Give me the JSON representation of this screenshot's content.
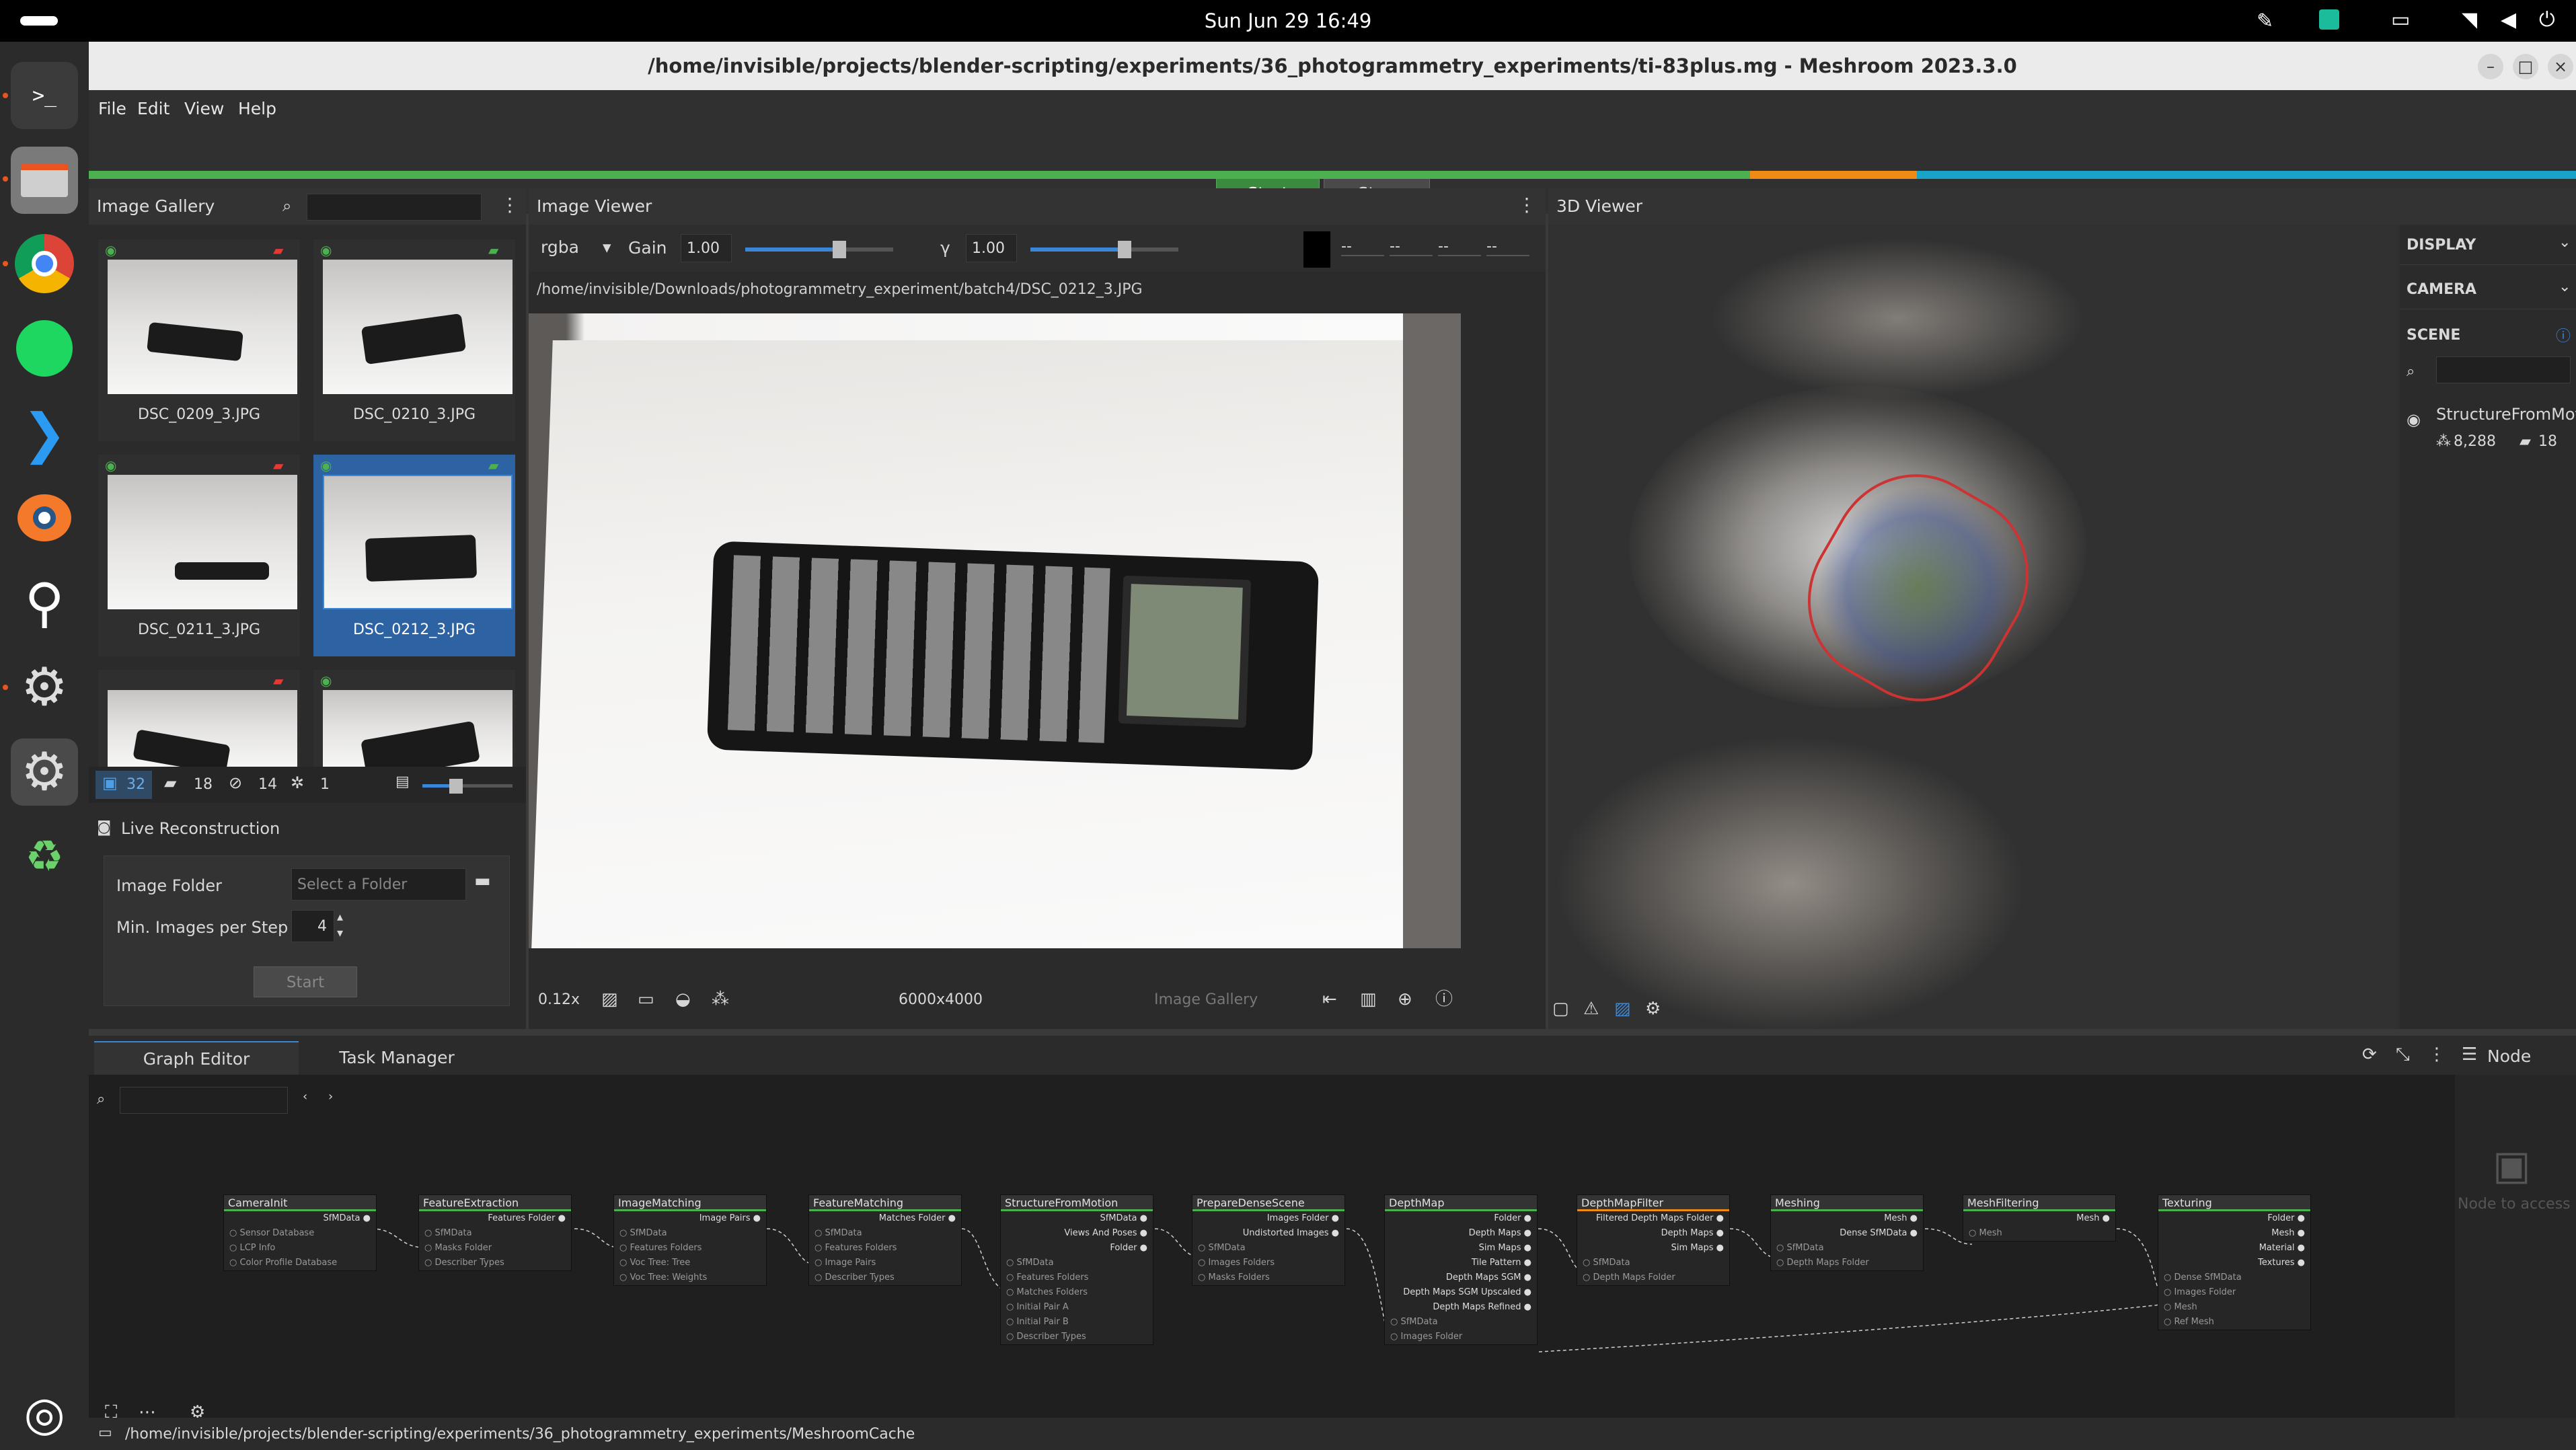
{
  "topbar": {
    "clock": "Sun Jun 29  16:49"
  },
  "window": {
    "title": "/home/invisible/projects/blender-scripting/experiments/36_photogrammetry_experiments/ti-83plus.mg - Meshroom 2023.3.0"
  },
  "menu": [
    "File",
    "Edit",
    "View",
    "Help"
  ],
  "actions": {
    "start": "Start",
    "stop": "Stop"
  },
  "gallery": {
    "title": "Image Gallery",
    "images": [
      {
        "name": "DSC_0209_3.JPG"
      },
      {
        "name": "DSC_0210_3.JPG"
      },
      {
        "name": "DSC_0211_3.JPG"
      },
      {
        "name": "DSC_0212_3.JPG"
      },
      {
        "name": "",
        "hidden": true
      },
      {
        "name": "",
        "hidden": true
      }
    ],
    "counts": {
      "images": "32",
      "cameras": "18",
      "no_cameras": "14",
      "intrinsics": "1"
    }
  },
  "live": {
    "title": "Live Reconstruction",
    "folder_label": "Image Folder",
    "folder_placeholder": "Select a Folder",
    "min_label": "Min. Images per Step",
    "min_value": "4",
    "start": "Start"
  },
  "viewer": {
    "title": "Image Viewer",
    "channel": "rgba",
    "gain_label": "Gain",
    "gain": "1.00",
    "gamma_label": "γ",
    "gamma": "1.00",
    "rgba_vals": [
      "--",
      "--",
      "--",
      "--"
    ],
    "path": "/home/invisible/Downloads/photogrammetry_experiment/batch4/DSC_0212_3.JPG",
    "zoom": "0.12x",
    "resolution": "6000x4000",
    "source": "Image Gallery"
  },
  "viewer3d": {
    "title": "3D Viewer",
    "sections": {
      "display": "DISPLAY",
      "camera": "CAMERA",
      "scene": "SCENE"
    },
    "scene_item": "StructureFromMotion",
    "points": "8,288",
    "cameras": "18"
  },
  "graph": {
    "tabs": [
      "Graph Editor",
      "Task Manager"
    ],
    "node_label": "Node",
    "node_placeholder": "Node to access i",
    "nodes": [
      {
        "name": "CameraInit",
        "outs": [
          "SfMData"
        ],
        "ins": [
          "Sensor Database",
          "LCP Info",
          "Color Profile Database"
        ]
      },
      {
        "name": "FeatureExtraction",
        "outs": [
          "Features Folder"
        ],
        "ins": [
          "SfMData",
          "Masks Folder",
          "Describer Types"
        ]
      },
      {
        "name": "ImageMatching",
        "outs": [
          "Image Pairs"
        ],
        "ins": [
          "SfMData",
          "Features Folders",
          "Voc Tree: Tree",
          "Voc Tree: Weights"
        ]
      },
      {
        "name": "FeatureMatching",
        "outs": [
          "Matches Folder"
        ],
        "ins": [
          "SfMData",
          "Features Folders",
          "Image Pairs",
          "Describer Types"
        ]
      },
      {
        "name": "StructureFromMotion",
        "outs": [
          "SfMData",
          "Views And Poses",
          "Folder"
        ],
        "ins": [
          "SfMData",
          "Features Folders",
          "Matches Folders",
          "Initial Pair A",
          "Initial Pair B",
          "Describer Types"
        ]
      },
      {
        "name": "PrepareDenseScene",
        "outs": [
          "Images Folder",
          "Undistorted Images"
        ],
        "ins": [
          "SfMData",
          "Images Folders",
          "Masks Folders"
        ]
      },
      {
        "name": "DepthMap",
        "outs": [
          "Folder",
          "Depth Maps",
          "Sim Maps",
          "Tile Pattern",
          "Depth Maps SGM",
          "Depth Maps SGM Upscaled",
          "Depth Maps Refined"
        ],
        "ins": [
          "SfMData",
          "Images Folder"
        ]
      },
      {
        "name": "DepthMapFilter",
        "outs": [
          "Filtered Depth Maps Folder",
          "Depth Maps",
          "Sim Maps"
        ],
        "ins": [
          "SfMData",
          "Depth Maps Folder"
        ]
      },
      {
        "name": "Meshing",
        "outs": [
          "Mesh",
          "Dense SfMData"
        ],
        "ins": [
          "SfMData",
          "Depth Maps Folder"
        ]
      },
      {
        "name": "MeshFiltering",
        "outs": [
          "Mesh"
        ],
        "ins": [
          "Mesh"
        ]
      },
      {
        "name": "Texturing",
        "outs": [
          "Folder",
          "Mesh",
          "Material",
          "Textures"
        ],
        "ins": [
          "Dense SfMData",
          "Images Folder",
          "Mesh",
          "Ref Mesh"
        ]
      }
    ]
  },
  "status": {
    "path": "/home/invisible/projects/blender-scripting/experiments/36_photogrammetry_experiments/MeshroomCache"
  },
  "colors": {
    "accent_green": "#4caf50",
    "progress_orange": "#ef8a17",
    "progress_blue": "#1aa3c9",
    "selection": "#2d62a3"
  }
}
